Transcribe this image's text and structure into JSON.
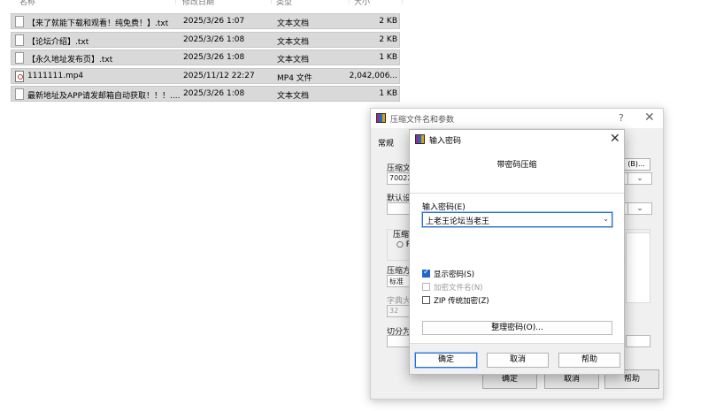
{
  "file_list": {
    "headers": {
      "name": "名称",
      "date": "修改日期",
      "type": "类型",
      "size": "大小"
    },
    "files": [
      {
        "name": "【来了就能下载和观看！纯免费！】.txt",
        "date": "2025/3/26 1:07",
        "type": "文本文档",
        "size": "2 KB",
        "icon": "text-file-icon"
      },
      {
        "name": "【论坛介绍】.txt",
        "date": "2025/3/26 1:08",
        "type": "文本文档",
        "size": "2 KB",
        "icon": "text-file-icon"
      },
      {
        "name": "【永久地址发布页】.txt",
        "date": "2025/3/26 1:08",
        "type": "文本文档",
        "size": "1 KB",
        "icon": "text-file-icon"
      },
      {
        "name": "1111111.mp4",
        "date": "2025/11/12 22:27",
        "type": "MP4 文件",
        "size": "2,042,006...",
        "icon": "video-file-icon"
      },
      {
        "name": "最新地址及APP请发邮箱自动获取！！！....",
        "date": "2025/3/26 1:08",
        "type": "文本文档",
        "size": "1 KB",
        "icon": "text-file-icon"
      }
    ]
  },
  "bg_dialog": {
    "title": "压缩文件名和参数",
    "help": "?",
    "close": "✕",
    "tab": "常规",
    "archive_label": "压缩文",
    "archive_value": "70022",
    "browse_label": "(B)...",
    "default_label": "默认设",
    "format_label": "压缩:",
    "format_radio": "○ R",
    "method_label": "压缩方",
    "method_value": "标准",
    "dict_label": "字典大",
    "dict_value": "32",
    "split_label": "切分为",
    "ok": "确定",
    "cancel": "取消",
    "help_btn": "帮助"
  },
  "pw_dialog": {
    "title": "输入密码",
    "close": "✕",
    "header": "带密码压缩",
    "password_label": "输入密码(E)",
    "password_value": "上老王论坛当老王",
    "checkboxes": [
      {
        "label": "显示密码(S)",
        "checked": true,
        "disabled": false
      },
      {
        "label": "加密文件名(N)",
        "checked": false,
        "disabled": true
      },
      {
        "label": "ZIP 传统加密(Z)",
        "checked": false,
        "disabled": false
      }
    ],
    "organize": "整理密码(O)...",
    "ok": "确定",
    "cancel": "取消",
    "help": "帮助"
  },
  "colors": {
    "accent": "#2c6fcf",
    "selection": "#d9d9d9"
  }
}
